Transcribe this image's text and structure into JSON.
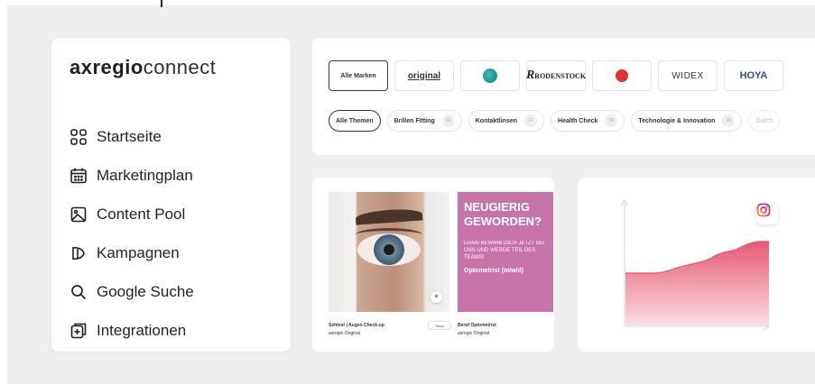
{
  "app": {
    "logo_part1": "axregio",
    "logo_part2": "connect"
  },
  "sidebar": {
    "items": [
      {
        "label": "Startseite",
        "icon": "grid-icon"
      },
      {
        "label": "Marketingplan",
        "icon": "calendar-icon"
      },
      {
        "label": "Content Pool",
        "icon": "image-icon"
      },
      {
        "label": "Kampagnen",
        "icon": "megaphone-icon"
      },
      {
        "label": "Google Suche",
        "icon": "search-icon"
      },
      {
        "label": "Integrationen",
        "icon": "plug-in-icon"
      }
    ]
  },
  "filters": {
    "brands": [
      {
        "label": "Alle Marken",
        "active": true
      },
      {
        "label": "original",
        "active": false
      },
      {
        "label": "",
        "active": false
      },
      {
        "label": "RODENSTOCK",
        "active": false
      },
      {
        "label": "",
        "active": false
      },
      {
        "label": "WIDEX",
        "active": false
      },
      {
        "label": "HOYA",
        "active": false
      }
    ],
    "topics": [
      {
        "label": "Alle Themen",
        "count": "",
        "active": true
      },
      {
        "label": "Brillen Fitting",
        "count": "16"
      },
      {
        "label": "Kontaktlinsen",
        "count": "11"
      },
      {
        "label": "Health Check",
        "count": "26"
      },
      {
        "label": "Technologie & Innovation",
        "count": "25"
      },
      {
        "label": "Durch",
        "count": ""
      }
    ]
  },
  "content_card": {
    "promo_heading": "NEUGIERIG GEWORDEN?",
    "promo_text": "DANN BEWIRB DICH JETZT BEI UNS UND WERDE TEIL DES TEAMS!",
    "promo_role": "Optometrist (m/w/d)",
    "caption1_title": "Sehtest | Augen Check-up",
    "caption1_sub": "axregio Original",
    "caption1_tag": "Story",
    "caption2_title": "Beruf Optometrist",
    "caption2_sub": "axregio Original"
  },
  "chart_card": {
    "icon": "instagram-icon",
    "colors": {
      "area_top": "#e85a75",
      "area_bottom": "#f7d6dc",
      "line": "#e25470"
    }
  },
  "colors": {
    "background": "#efefef",
    "promo": "#c774a8"
  }
}
